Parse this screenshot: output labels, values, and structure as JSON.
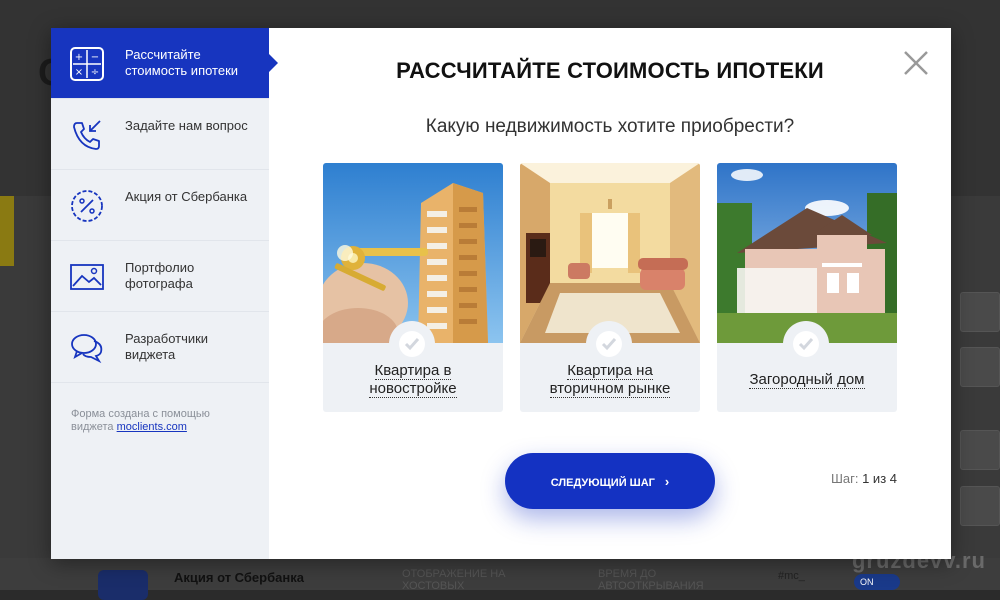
{
  "background": {
    "letter": "С",
    "row_title": "Акция от Сбербанка",
    "row_col2": "ОТОБРАЖЕНИЕ НА ХОСТОВЫХ",
    "row_col3": "ВРЕМЯ ДО АВТООТКРЫВАНИЯ",
    "row_col4": "#mc_",
    "row_toggle": "ON",
    "watermark": "gruzdevv.ru"
  },
  "sidebar": {
    "items": [
      {
        "label": "Рассчитайте стоимость ипотеки",
        "icon": "calculator-icon",
        "active": true
      },
      {
        "label": "Задайте нам вопрос",
        "icon": "phone-call-icon",
        "active": false
      },
      {
        "label": "Акция от Сбербанка",
        "icon": "discount-badge-icon",
        "active": false
      },
      {
        "label": "Портфолио фотографа",
        "icon": "image-icon",
        "active": false
      },
      {
        "label": "Разработчики виджета",
        "icon": "chat-bubbles-icon",
        "active": false
      }
    ],
    "credit_text": "Форма создана с помощью виджета ",
    "credit_link": "moclients.com"
  },
  "main": {
    "title": "РАССЧИТАЙТЕ СТОИМОСТЬ ИПОТЕКИ",
    "subtitle": "Какую недвижимость хотите приобрести?",
    "options": [
      {
        "line1": "Квартира в",
        "line2": "новостройке"
      },
      {
        "line1": "Квартира на",
        "line2": "вторичном рынке"
      },
      {
        "line1": "Загородный дом",
        "line2": ""
      }
    ],
    "next_button": "Следующий шаг",
    "step_label": "Шаг:",
    "step_value": "1 из 4"
  },
  "colors": {
    "accent": "#1735bf",
    "sidebar_bg": "#eef1f5"
  }
}
